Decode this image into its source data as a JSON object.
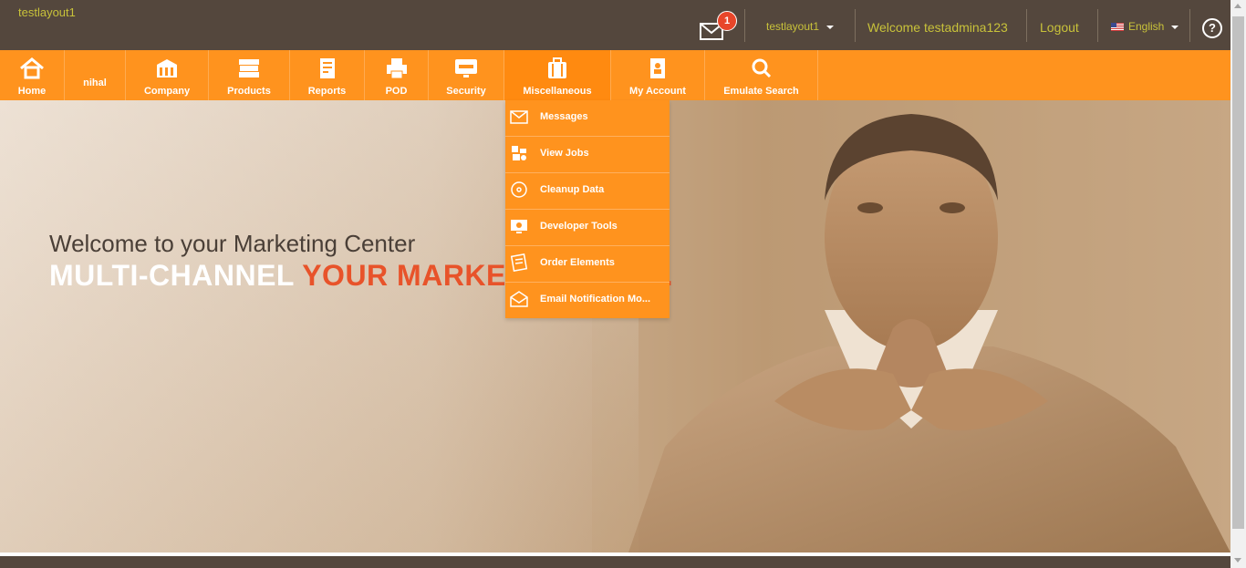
{
  "topbar": {
    "site_name": "testlayout1",
    "messages_count": "1",
    "account_label": "testlayout1",
    "welcome_text": "Welcome testadmina123",
    "logout_label": "Logout",
    "language_label": "English",
    "help_label": "?"
  },
  "nav": {
    "items": [
      {
        "label": "Home",
        "icon": "home-icon"
      },
      {
        "label": "nihal",
        "icon": ""
      },
      {
        "label": "Company",
        "icon": "building-icon"
      },
      {
        "label": "Products",
        "icon": "books-icon"
      },
      {
        "label": "Reports",
        "icon": "report-icon"
      },
      {
        "label": "POD",
        "icon": "printer-icon"
      },
      {
        "label": "Security",
        "icon": "monitor-lock-icon"
      },
      {
        "label": "Miscellaneous",
        "icon": "briefcase-icon"
      },
      {
        "label": "My Account",
        "icon": "account-book-icon"
      },
      {
        "label": "Emulate Search",
        "icon": "search-icon"
      }
    ]
  },
  "dropdown": {
    "items": [
      {
        "label": "Messages",
        "icon": "envelope-icon"
      },
      {
        "label": "View Jobs",
        "icon": "jobs-icon"
      },
      {
        "label": "Cleanup Data",
        "icon": "disc-icon"
      },
      {
        "label": "Developer Tools",
        "icon": "monitor-tools-icon"
      },
      {
        "label": "Order Elements",
        "icon": "order-list-icon"
      },
      {
        "label": "Email Notification Mo...",
        "icon": "mail-notify-icon"
      }
    ]
  },
  "hero": {
    "line1": "Welcome to your Marketing Center",
    "line2_white": "MULTI-CHANNEL ",
    "line2_accent": "YOUR MARKETING IS US."
  },
  "colors": {
    "topbar": "#54473d",
    "nav": "#ff931e",
    "accent_text": "#c8c23a",
    "hero_accent": "#e8532a"
  }
}
